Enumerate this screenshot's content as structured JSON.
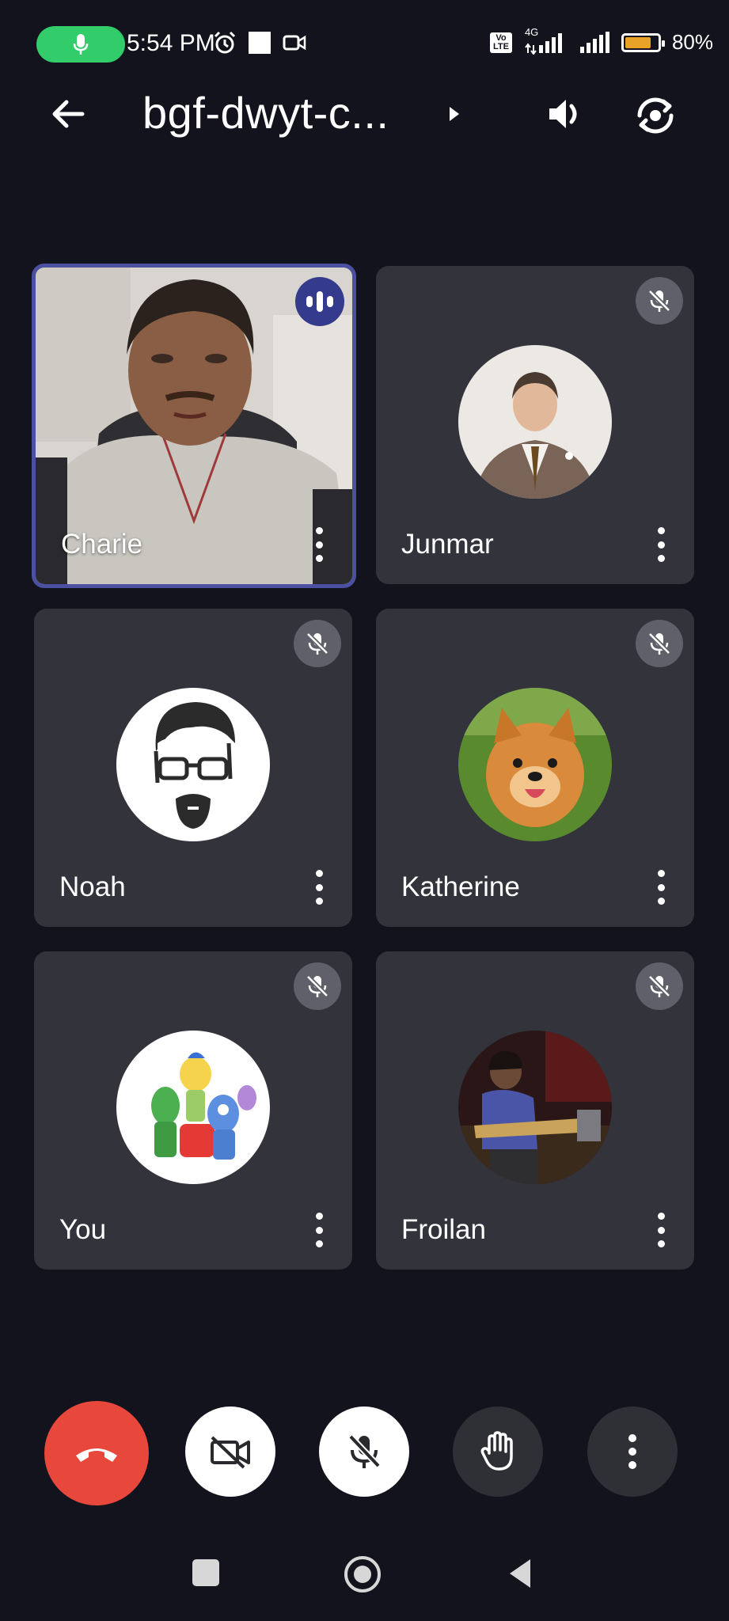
{
  "status_bar": {
    "time": "5:54 PM",
    "battery_percent": "80%",
    "network_volte": "Vo LTE",
    "network_gen": "4G",
    "battery_level": 0.8
  },
  "header": {
    "title": "bgf-dwyt-c..."
  },
  "tiles": [
    {
      "name": "Charie",
      "muted": false,
      "speaking": true
    },
    {
      "name": "Junmar",
      "muted": true
    },
    {
      "name": "Noah",
      "muted": true
    },
    {
      "name": "Katherine",
      "muted": true
    },
    {
      "name": "You",
      "muted": true
    },
    {
      "name": "Froilan",
      "muted": true
    }
  ],
  "controls": {
    "colors": {
      "end_call": "#e8473b",
      "active_white": "#ffffff",
      "inactive_dark": "#2f2f36"
    },
    "icons": [
      "end-call-icon",
      "camera-off-icon",
      "mic-off-icon",
      "raise-hand-icon",
      "more-options-icon"
    ]
  },
  "colors": {
    "background": "#13131d",
    "tile": "#33333c",
    "active_border": "#4b50a0",
    "status_pill": "#32cd6a"
  }
}
